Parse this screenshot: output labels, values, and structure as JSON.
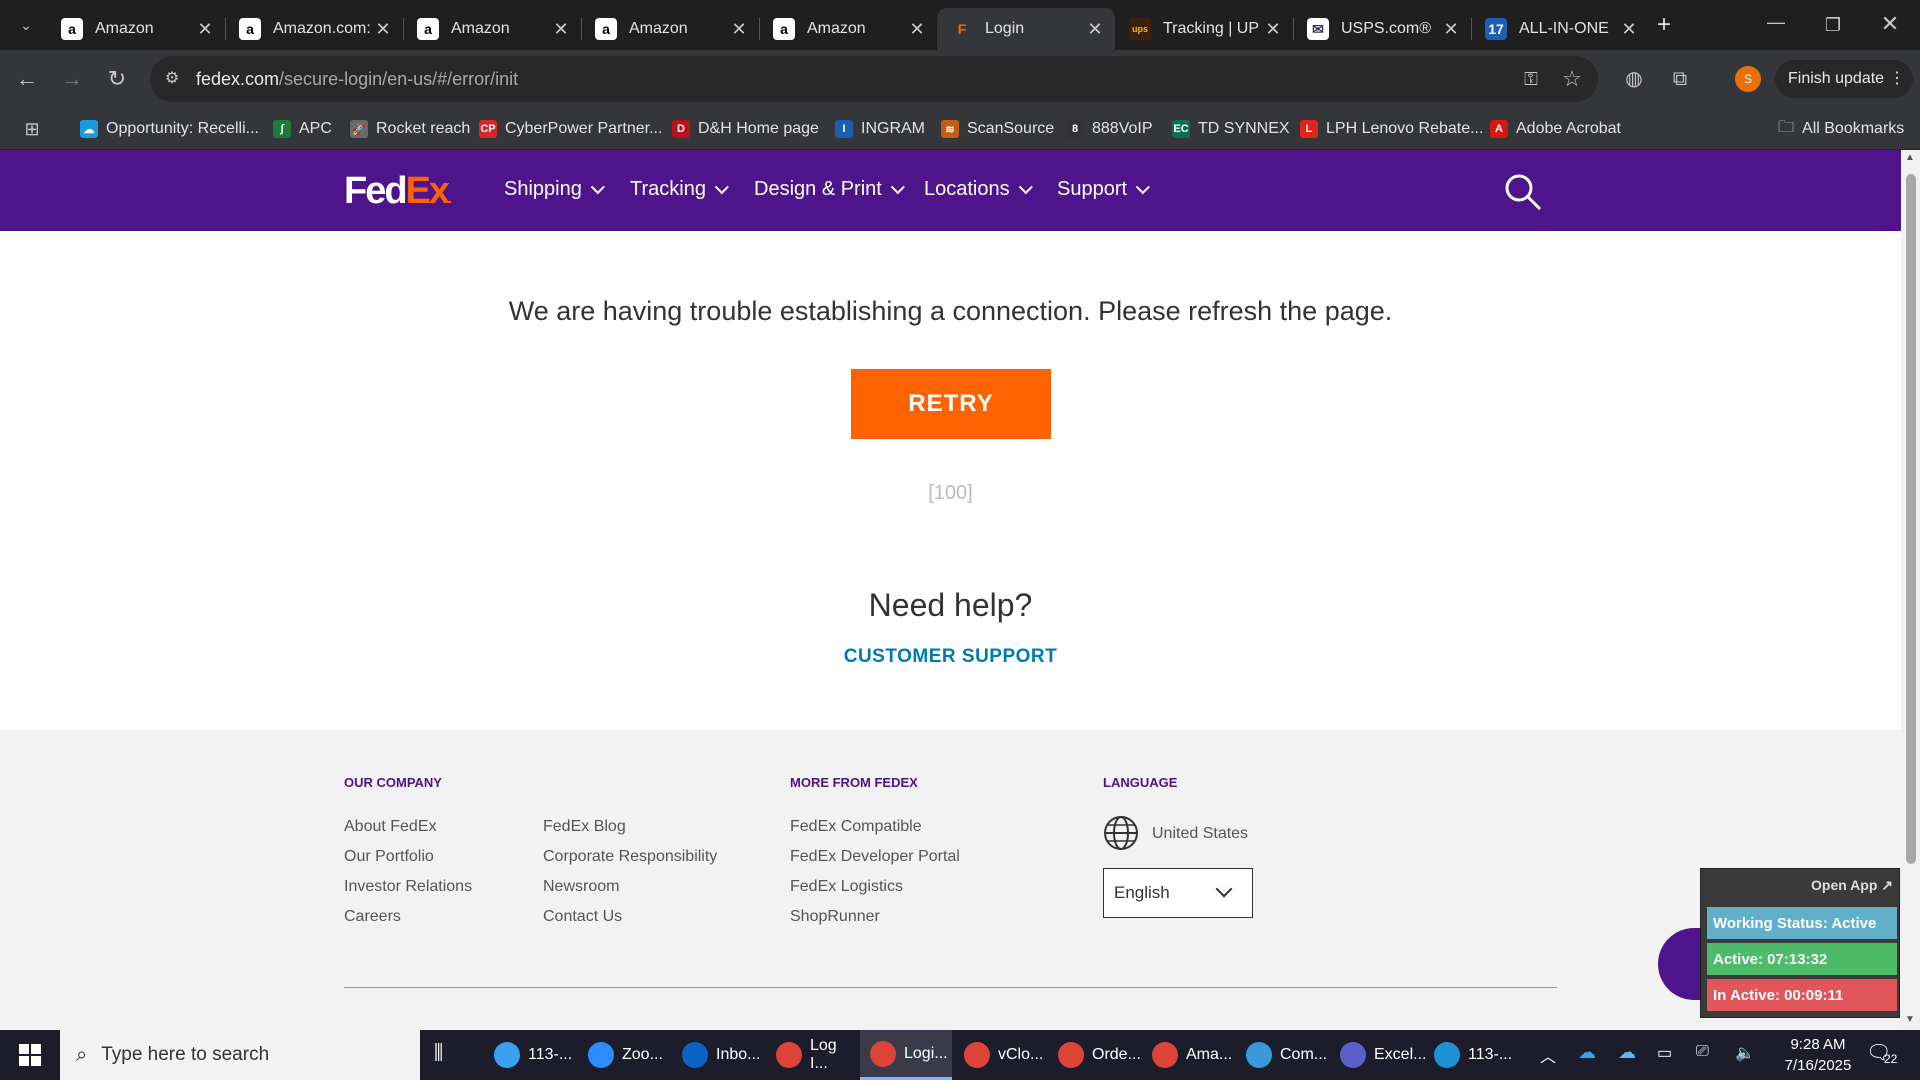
{
  "browser": {
    "tabs": [
      {
        "title": "Amazon",
        "favicon": "amazon-icon"
      },
      {
        "title": "Amazon.com:",
        "favicon": "amazon-icon"
      },
      {
        "title": "Amazon",
        "favicon": "amazon-icon"
      },
      {
        "title": "Amazon",
        "favicon": "amazon-icon"
      },
      {
        "title": "Amazon",
        "favicon": "amazon-icon"
      },
      {
        "title": "Login",
        "favicon": "fedex-icon",
        "active": true
      },
      {
        "title": "Tracking | UP",
        "favicon": "ups-icon"
      },
      {
        "title": "USPS.com®",
        "favicon": "usps-icon"
      },
      {
        "title": "ALL-IN-ONE",
        "favicon": "17track-icon"
      }
    ],
    "url_domain": "fedex.com",
    "url_path": "/secure-login/en-us/#/error/init",
    "profile_initial": "S",
    "finish_update": "Finish update",
    "all_bookmarks": "All Bookmarks",
    "bookmarks": [
      {
        "label": "Opportunity: Recelli...",
        "color": "#1a9be0"
      },
      {
        "label": "APC",
        "color": "#1d7a3a"
      },
      {
        "label": "Rocket reach",
        "color": "#6a6a6a"
      },
      {
        "label": "CyberPower Partner...",
        "color": "#d7262b"
      },
      {
        "label": "D&H Home page",
        "color": "#b5121b"
      },
      {
        "label": "INGRAM",
        "color": "#1a5fb4"
      },
      {
        "label": "ScanSource",
        "color": "#c55a11"
      },
      {
        "label": "888VoIP",
        "color": "#333333"
      },
      {
        "label": "TD SYNNEX",
        "color": "#0b6e4f"
      },
      {
        "label": "LPH Lenovo Rebate...",
        "color": "#e2231a"
      },
      {
        "label": "Adobe Acrobat",
        "color": "#d4170f"
      }
    ]
  },
  "fedex": {
    "logo_fed": "Fed",
    "logo_ex": "Ex",
    "nav": [
      "Shipping",
      "Tracking",
      "Design & Print",
      "Locations",
      "Support"
    ],
    "error_message": "We are having trouble establishing a connection. Please refresh the page.",
    "retry_label": "RETRY",
    "error_code": "[100]",
    "need_help": "Need help?",
    "customer_support": "CUSTOMER SUPPORT",
    "footer": {
      "our_company_heading": "OUR COMPANY",
      "col1": [
        "About FedEx",
        "Our Portfolio",
        "Investor Relations",
        "Careers"
      ],
      "col2": [
        "FedEx Blog",
        "Corporate Responsibility",
        "Newsroom",
        "Contact Us"
      ],
      "more_heading": "MORE FROM FEDEX",
      "col3": [
        "FedEx Compatible",
        "FedEx Developer Portal",
        "FedEx Logistics",
        "ShopRunner"
      ],
      "language_heading": "LANGUAGE",
      "country": "United States",
      "language": "English"
    },
    "brand_colors": {
      "purple": "#4d148c",
      "orange": "#ff6200",
      "link": "#007ab7"
    }
  },
  "widget": {
    "open_app": "Open App ↗",
    "working_status": "Working Status: Active",
    "active_timer": "Active: 07:13:32",
    "inactive_timer": "In Active: 00:09:11"
  },
  "taskbar": {
    "search_placeholder": "Type here to search",
    "apps": [
      {
        "label": "113-...",
        "icon": "files-icon",
        "color": "#3aa0f0"
      },
      {
        "label": "Zoo...",
        "icon": "zoom-icon",
        "color": "#2d8cff"
      },
      {
        "label": "Inbo...",
        "icon": "outlook-icon",
        "color": "#0a64c8"
      },
      {
        "label": "Log I...",
        "icon": "chrome-icon",
        "color": "#db4437"
      },
      {
        "label": "Logi...",
        "icon": "chrome-icon",
        "color": "#db4437",
        "active": true
      },
      {
        "label": "vClo...",
        "icon": "chrome-icon",
        "color": "#db4437"
      },
      {
        "label": "Orde...",
        "icon": "chrome-icon",
        "color": "#db4437"
      },
      {
        "label": "Ama...",
        "icon": "chrome-icon",
        "color": "#db4437"
      },
      {
        "label": "Com...",
        "icon": "app-icon",
        "color": "#3a9ad9"
      },
      {
        "label": "Excel...",
        "icon": "teams-icon",
        "color": "#5b5fc7"
      },
      {
        "label": "113-...",
        "icon": "edge-icon",
        "color": "#1e90d6"
      }
    ],
    "time": "9:28 AM",
    "date": "7/16/2025",
    "notifications": "22"
  }
}
